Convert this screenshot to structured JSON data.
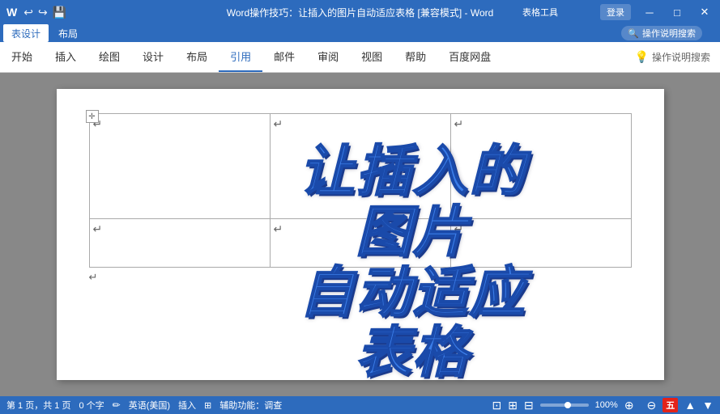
{
  "titleBar": {
    "quickAccess": [
      "↩",
      "↪",
      "💾"
    ],
    "title": "Word操作技巧：让插入的图片自动适应表格 [兼容模式] - Word",
    "tableToolsLabel": "表格工具",
    "loginLabel": "登录",
    "winButtons": [
      "□",
      "－",
      "✕"
    ]
  },
  "ribbon": {
    "tabs": [
      "表设计",
      "布局"
    ],
    "searchPlaceholder": "操作说明搜索",
    "searchIcon": "🔍"
  },
  "menuBar": {
    "tabs": [
      "开始",
      "插入",
      "绘图",
      "设计",
      "布局",
      "引用",
      "邮件",
      "审阅",
      "视图",
      "帮助",
      "百度网盘"
    ],
    "activeTab": "引用",
    "searchText": "操作说明搜索"
  },
  "document": {
    "table": {
      "rows": 2,
      "cols": 3,
      "cells": [
        [
          "",
          "",
          ""
        ],
        [
          "",
          "",
          ""
        ]
      ]
    },
    "bigTitle": "让插入的\n图片\n自动适应\n表格"
  },
  "statusBar": {
    "pageInfo": "第 1 页，共 1 页",
    "wordCount": "0 个字",
    "language": "英语(美国)",
    "insertMode": "插入",
    "accessibility": "辅助功能：调查",
    "zoomLevel": "100%",
    "viewIcons": [
      "📄",
      "📑",
      "📋"
    ],
    "wpsLabel": "五"
  }
}
